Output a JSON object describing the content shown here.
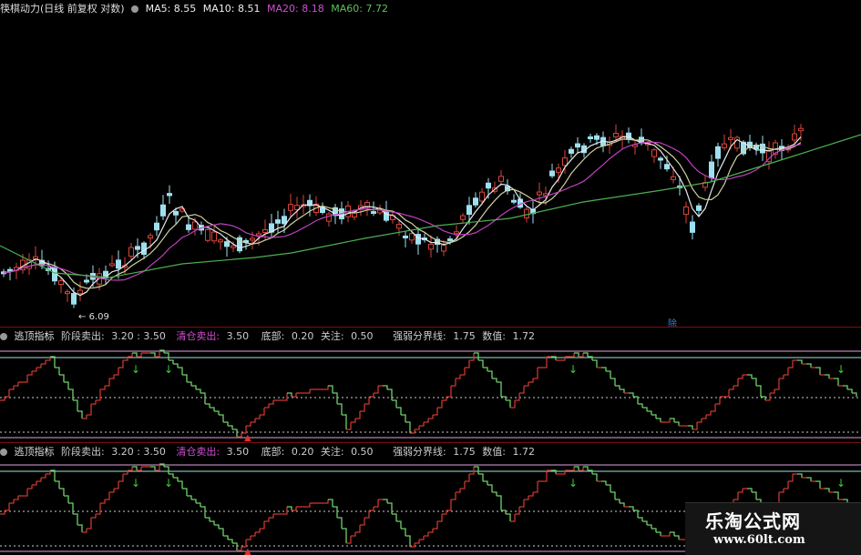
{
  "main_header": {
    "title": "筷棋动力(日线 前复权 对数)",
    "ma5": "MA5: 8.55",
    "ma10": "MA10: 8.51",
    "ma20": "MA20: 8.18",
    "ma60": "MA60: 7.72"
  },
  "price_chart": {
    "min_label": "6.09",
    "tag_label": "除"
  },
  "indicator_panel_1": {
    "name": "逃顶指标",
    "stage_label": "阶段卖出:",
    "stage_values": "3.20 : 3.50",
    "clear_label": "清仓卖出:",
    "clear_value": "3.50",
    "bottom_label": "底部:",
    "bottom_value": "0.20",
    "watch_label": "关注:",
    "watch_value": "0.50",
    "boundary_label": "强弱分界线:",
    "boundary_value": "1.75",
    "value_label": "数值:",
    "value_value": "1.72"
  },
  "indicator_panel_2": {
    "name": "逃顶指标",
    "stage_label": "阶段卖出:",
    "stage_values": "3.20 : 3.50",
    "clear_label": "清仓卖出:",
    "clear_value": "3.50",
    "bottom_label": "底部:",
    "bottom_value": "0.20",
    "watch_label": "关注:",
    "watch_value": "0.50",
    "boundary_label": "强弱分界线:",
    "boundary_value": "1.75",
    "value_label": "数值:",
    "value_value": "1.72"
  },
  "watermark": {
    "line1": "乐淘公式网",
    "line2": "www.60lt.com"
  },
  "colors": {
    "up": "#d8453a",
    "down": "#9fe0f0",
    "ma5": "#e8e8e8",
    "ma10": "#d0d0a0",
    "ma20": "#c040c0",
    "ma60": "#4caf50",
    "osc_up": "#c8382e",
    "osc_down": "#6fd06a"
  }
}
